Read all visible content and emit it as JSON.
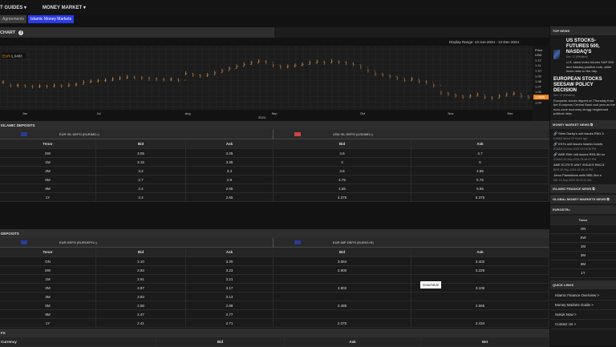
{
  "nav": {
    "items": [
      "T GUIDES ▾",
      "MONEY MARKET ▾"
    ]
  },
  "subtabs": [
    {
      "label": "Agreements",
      "active": false
    },
    {
      "label": "Islamic Money Markets",
      "active": true
    }
  ],
  "chart": {
    "title": "CHART",
    "display_range": "Display Range: 13-Jun-2024 - 12-Dec-2024",
    "legend": "EUR=",
    "legend_value": "1.0488",
    "price_label": "Price",
    "currency": "USD",
    "current_price": "1.0500",
    "year": "2024"
  },
  "chart_data": {
    "type": "line",
    "title": "",
    "xlabel": "",
    "ylabel": "Price",
    "x_ticks": [
      "Jun",
      "Jul",
      "Aug",
      "Sep",
      "Oct",
      "Nov",
      "Dec"
    ],
    "y_ticks": [
      "1.12",
      "1.11",
      "1.10",
      "1.09",
      "1.08",
      "1.07",
      "1.06",
      "1.04"
    ],
    "ylim": [
      1.035,
      1.13
    ],
    "series": [
      {
        "values": [
          1.078,
          1.072,
          1.072,
          1.071,
          1.07,
          1.071,
          1.07,
          1.072,
          1.071,
          1.073,
          1.074,
          1.078,
          1.08,
          1.081,
          1.082,
          1.084,
          1.086,
          1.088,
          1.087,
          1.086,
          1.085,
          1.084,
          1.083,
          1.084,
          1.082,
          1.095,
          1.092,
          1.09,
          1.092,
          1.096,
          1.1,
          1.104,
          1.108,
          1.112,
          1.115,
          1.118,
          1.116,
          1.11,
          1.107,
          1.108,
          1.11,
          1.112,
          1.115,
          1.117,
          1.115,
          1.118,
          1.116,
          1.114,
          1.112,
          1.107,
          1.1,
          1.094,
          1.092,
          1.089,
          1.086,
          1.082,
          1.084,
          1.08,
          1.078,
          1.072,
          1.058,
          1.056,
          1.053,
          1.05,
          1.052,
          1.055,
          1.05,
          1.048,
          1.052,
          1.055,
          1.057,
          1.052,
          1.05
        ]
      }
    ]
  },
  "islamic": {
    "title": "ISLAMIC DEPOSITS",
    "left": {
      "title": "EUR ISL DEPO (EURIMD=)",
      "headers": [
        "Tenor",
        "Bid",
        "Ask"
      ],
      "rows": [
        [
          "SW",
          "3.05",
          "3.25"
        ],
        [
          "1M",
          "3.15",
          "3.35"
        ],
        [
          "2M",
          "3.2",
          "3.4"
        ],
        [
          "6M",
          "2.7",
          "2.9"
        ],
        [
          "9M",
          "2.4",
          "2.65"
        ],
        [
          "1Y",
          "2.4",
          "2.65"
        ]
      ]
    },
    "right": {
      "title": "USD ISL DEPO (USDIMD=)",
      "headers": [
        "Bid",
        "Ask"
      ],
      "rows": [
        [
          "4.6",
          "4.7"
        ],
        [
          "4",
          "5"
        ],
        [
          "4.6",
          "4.85"
        ],
        [
          "4.75",
          "5.75"
        ],
        [
          "4.65",
          "5.65"
        ],
        [
          "4.375",
          "5.375"
        ]
      ]
    }
  },
  "deposits": {
    "title": "DEPOSITS",
    "left": {
      "title": "EUR DEPO (EURDEPO=)",
      "headers": [
        "Tenor",
        "Bid",
        "Ask"
      ],
      "rows": [
        [
          "ON",
          "3.10",
          "3.30"
        ],
        [
          "SW",
          "2.93",
          "3.23"
        ],
        [
          "1M",
          "2.91",
          "3.21"
        ],
        [
          "2M",
          "2.87",
          "3.17"
        ],
        [
          "3M",
          "2.83",
          "3.13"
        ],
        [
          "6M",
          "2.58",
          "2.88"
        ],
        [
          "9M",
          "2.47",
          "2.77"
        ],
        [
          "1Y",
          "2.41",
          "2.71"
        ]
      ]
    },
    "right": {
      "title": "EUR IMP DEPO (EURIO=R)",
      "headers": [
        "Bid",
        "Ask"
      ],
      "rows": [
        [
          "3.084",
          "3.402"
        ],
        [
          "2.900",
          "3.229"
        ],
        [
          "",
          ""
        ],
        [
          "2.802",
          "3.106"
        ],
        [
          "",
          ""
        ],
        [
          "2.486",
          "2.565"
        ],
        [
          "",
          ""
        ],
        [
          "2.375",
          "2.434"
        ]
      ]
    }
  },
  "tooltip": "DataTable",
  "fx": {
    "title": "FX",
    "headers": [
      "Currency",
      "Bid",
      "Ask",
      "Net"
    ]
  },
  "sidebar": {
    "top_news": "TOP NEWS",
    "news": [
      {
        "title": "US STOCKS-FUTURES 500, NASDAQ'S",
        "meta": "Dec 12 (Reuters)",
        "body": "U.S. stock index futures S&P 500 and Nasdaq positive note, while inves data on the day."
      },
      {
        "title": "EUROPEAN STOCKS SEESAW POLICY DECISION",
        "meta": "Dec 12 (Reuters)",
        "body": "European stocks dipped on Thursday from the European Central Bank and year as the euro zone economy strugg heightened political risks."
      }
    ],
    "money_market_news": "MONEY MARKET NEWS",
    "mm_items": [
      {
        "title": "Sime Darby's unit issues RM1.3",
        "meta": "ICM&D  about 23 hours ago"
      },
      {
        "title": "IHH's unit issues Islamic bonds",
        "meta": "ICM&D  01-Nov-2024 02:04:36 PM"
      },
      {
        "title": "AME Elite unit issues RM1.8b su",
        "meta": "ICM&D  30-Sep-2024 03:48:47 PM"
      },
      {
        "title": "AME ELITE'S UNIT ISSUES RM1.8",
        "meta": "BER  30-Sep-2024 02:46:12 PM"
      },
      {
        "title": "Johor Plantations sells M$1.3bn s",
        "meta": "ISE  13-Sep-2024 06:02:31 AM"
      }
    ],
    "islamic_finance_news": "ISLAMIC FINANCE NEWS",
    "global_mm_news": "GLOBAL MONEY MARKETS NEWS",
    "eurostr": "EUROSTR=",
    "tenor_header": "Tenor",
    "tenors": [
      "ON",
      "SW",
      "1M",
      "3M",
      "6M",
      "1Y"
    ],
    "quick_links": "QUICK LINKS",
    "links": [
      "Islamic Finance Overview >",
      "Money Markets Guide >",
      "Sukuk Now >",
      "Contact Us >"
    ]
  },
  "colors": {
    "accent": "#2b3be8",
    "price_tag": "#f08a24",
    "bar_up": "#c98a4a",
    "bar_down": "#a06a3a"
  }
}
